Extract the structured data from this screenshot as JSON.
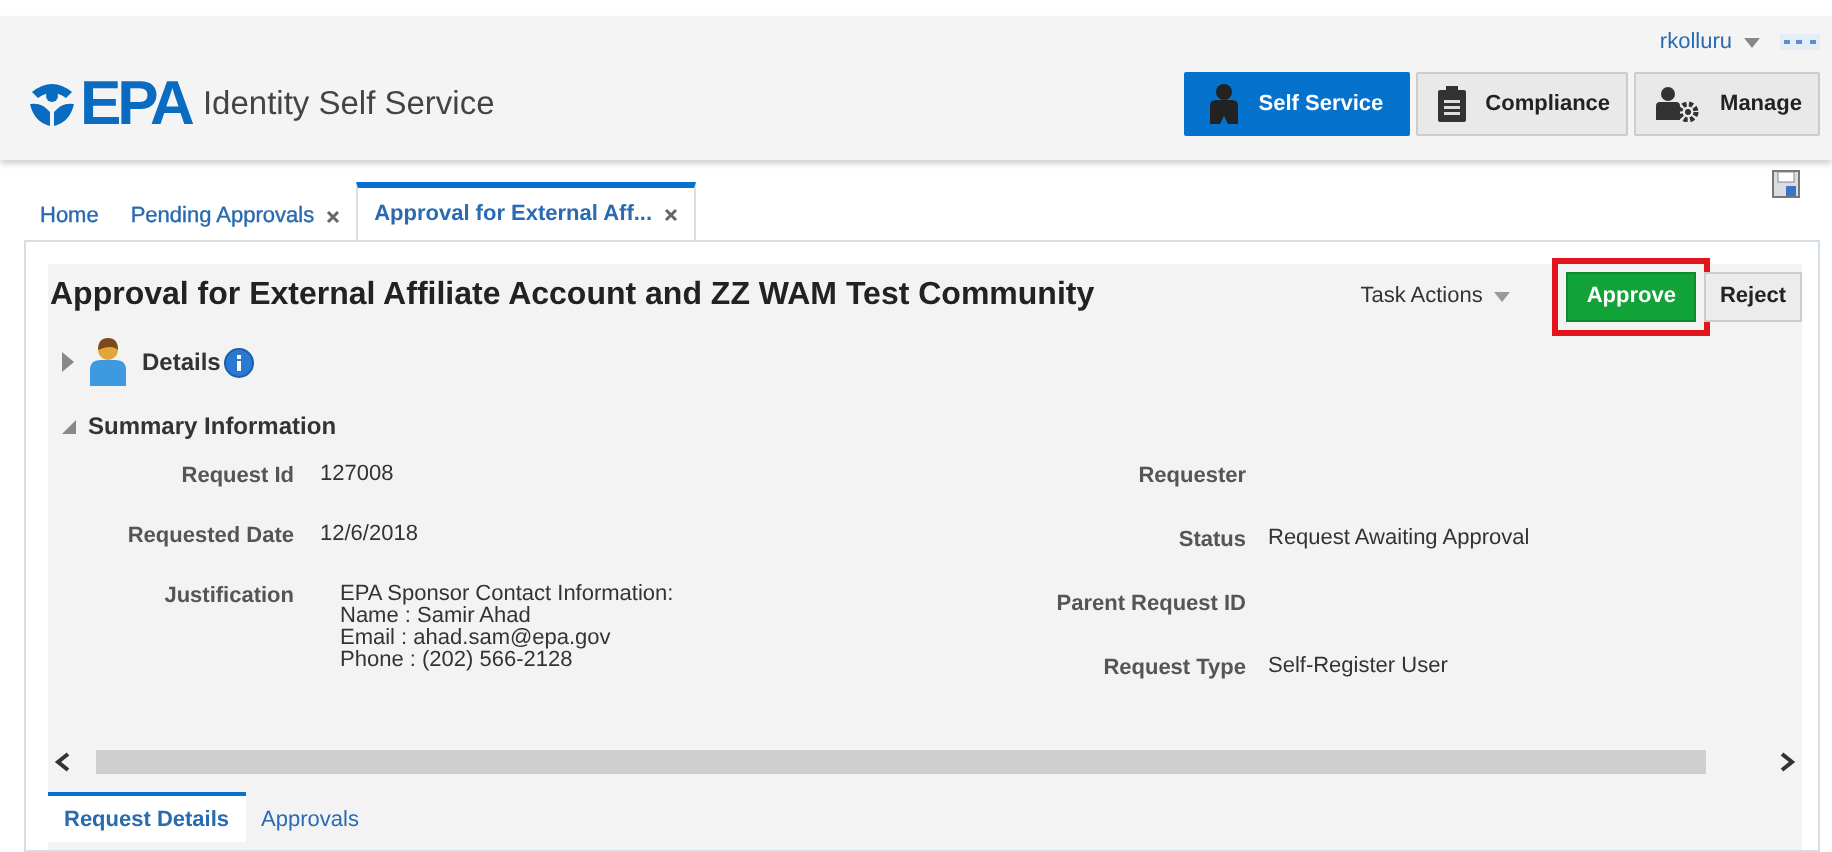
{
  "header": {
    "user": "rkolluru",
    "logo": "EPA",
    "app_title": "Identity Self Service",
    "nav_buttons": [
      {
        "label": "Self Service",
        "kind": "person",
        "selected": true
      },
      {
        "label": "Compliance",
        "kind": "clipboard",
        "selected": false
      },
      {
        "label": "Manage",
        "kind": "gear",
        "selected": false
      }
    ]
  },
  "tabs": [
    {
      "label": "Home",
      "closable": false,
      "selected": false
    },
    {
      "label": "Pending Approvals",
      "closable": true,
      "selected": false
    },
    {
      "label": "Approval for External Aff...",
      "closable": true,
      "selected": true
    }
  ],
  "task": {
    "title": "Approval for External Affiliate Account and ZZ WAM Test Community",
    "task_actions": "Task Actions",
    "actions": [
      {
        "label": "Approve",
        "kind": "primary",
        "highlighted": true
      },
      {
        "label": "Reject",
        "kind": "plain",
        "highlighted": false
      }
    ],
    "details": {
      "label": "Details",
      "expanded": false
    },
    "summary": {
      "label": "Summary Information",
      "expanded": true
    },
    "left_fields": [
      {
        "label": "Request Id",
        "value": "127008"
      },
      {
        "label": "Requested Date",
        "value": "12/6/2018"
      },
      {
        "label": "Justification",
        "value": "EPA Sponsor Contact Information:\nName : Samir Ahad\nEmail : ahad.sam@epa.gov\nPhone : (202) 566-2128"
      }
    ],
    "right_fields": [
      {
        "label": "Requester"
      },
      {
        "label": "Status",
        "value": "Request Awaiting Approval"
      },
      {
        "label": "Parent Request ID"
      },
      {
        "label": "Request Type",
        "value": "Self-Register User"
      }
    ]
  },
  "bottom_tabs": [
    {
      "label": "Request Details",
      "selected": true
    },
    {
      "label": "Approvals",
      "selected": false
    }
  ]
}
